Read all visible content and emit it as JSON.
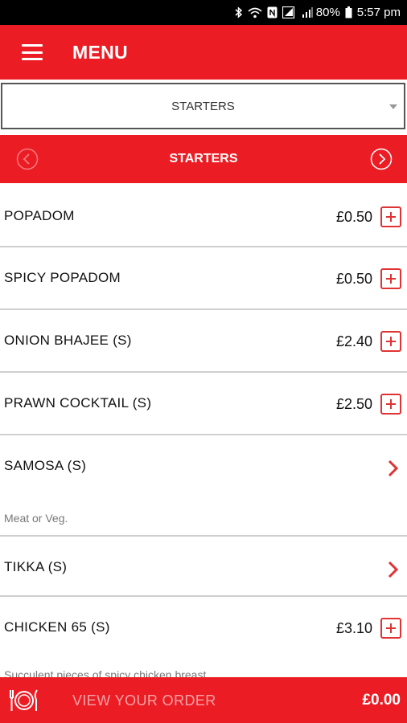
{
  "status_bar": {
    "battery_percent": "80%",
    "time": "5:57 pm",
    "icons": [
      "bluetooth-icon",
      "wifi-icon",
      "nfc-icon",
      "signal-icon",
      "signal-icon",
      "battery-icon"
    ]
  },
  "app_bar": {
    "title": "MENU",
    "menu_icon": "hamburger-icon"
  },
  "category_select": {
    "selected": "STARTERS"
  },
  "section": {
    "title": "STARTERS",
    "prev_icon": "chevron-left-circle-icon",
    "next_icon": "chevron-right-circle-icon"
  },
  "items": [
    {
      "name": "POPADOM",
      "price": "£0.50",
      "action": "add"
    },
    {
      "name": "SPICY POPADOM",
      "price": "£0.50",
      "action": "add"
    },
    {
      "name": "ONION BHAJEE (S)",
      "price": "£2.40",
      "action": "add"
    },
    {
      "name": "PRAWN COCKTAIL (S)",
      "price": "£2.50",
      "action": "add"
    },
    {
      "name": "SAMOSA (S)",
      "description": "Meat or Veg.",
      "action": "open"
    },
    {
      "name": "TIKKA (S)",
      "action": "open"
    },
    {
      "name": "CHICKEN 65 (S)",
      "price": "£3.10",
      "description": "Succulent pieces of spicy chicken breast",
      "action": "add"
    }
  ],
  "order_bar": {
    "label": "VIEW YOUR ORDER",
    "total": "£0.00",
    "icon": "plate-cutlery-icon"
  },
  "colors": {
    "brand_red": "#ec1c24",
    "add_button": "#e03333",
    "divider": "#cfcfcf"
  }
}
